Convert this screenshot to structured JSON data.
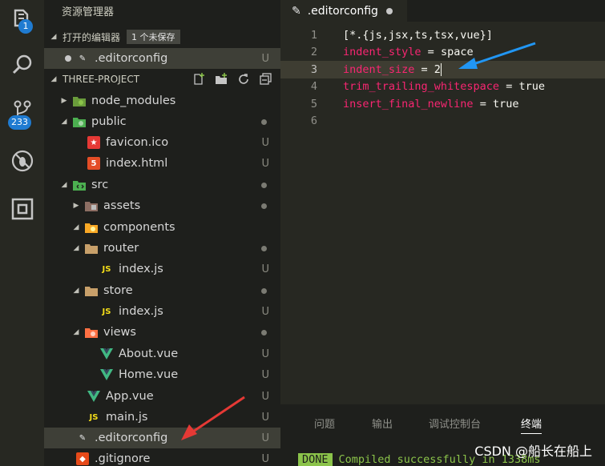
{
  "activity_bar": {
    "explorer_badge": "1",
    "scm_badge": "233"
  },
  "sidebar": {
    "title": "资源管理器",
    "open_editors": {
      "label": "打开的编辑器",
      "unsaved_badge": "1 个未保存",
      "items": [
        {
          "name": ".editorconfig",
          "status": "U"
        }
      ]
    },
    "project": {
      "label": "THREE-PROJECT"
    },
    "tree": [
      {
        "label": "node_modules",
        "status": "",
        "dot": false
      },
      {
        "label": "public",
        "status": "",
        "dot": true
      },
      {
        "label": "favicon.ico",
        "status": "U",
        "dot": false
      },
      {
        "label": "index.html",
        "status": "U",
        "dot": false
      },
      {
        "label": "src",
        "status": "",
        "dot": true
      },
      {
        "label": "assets",
        "status": "",
        "dot": true
      },
      {
        "label": "components",
        "status": "",
        "dot": false
      },
      {
        "label": "router",
        "status": "",
        "dot": true
      },
      {
        "label": "index.js",
        "status": "U",
        "dot": false
      },
      {
        "label": "store",
        "status": "",
        "dot": true
      },
      {
        "label": "index.js",
        "status": "U",
        "dot": false
      },
      {
        "label": "views",
        "status": "",
        "dot": true
      },
      {
        "label": "About.vue",
        "status": "U",
        "dot": false
      },
      {
        "label": "Home.vue",
        "status": "U",
        "dot": false
      },
      {
        "label": "App.vue",
        "status": "U",
        "dot": false
      },
      {
        "label": "main.js",
        "status": "U",
        "dot": false
      },
      {
        "label": ".editorconfig",
        "status": "U",
        "dot": false
      },
      {
        "label": ".gitignore",
        "status": "U",
        "dot": false
      }
    ],
    "icon_glyphs": {
      "js": "JS",
      "html": "5",
      "vue": "V"
    }
  },
  "editor": {
    "tab_label": ".editorconfig",
    "lines": [
      {
        "num": "1",
        "text": "[*.{js,jsx,ts,tsx,vue}]"
      },
      {
        "num": "2",
        "key": "indent_style",
        "eq": " = ",
        "val": "space"
      },
      {
        "num": "3",
        "key": "indent_size",
        "eq": " = ",
        "val": "2"
      },
      {
        "num": "4",
        "key": "trim_trailing_whitespace",
        "eq": " = ",
        "val": "true"
      },
      {
        "num": "5",
        "key": "insert_final_newline",
        "eq": " = ",
        "val": "true"
      },
      {
        "num": "6"
      }
    ]
  },
  "panel": {
    "tabs": [
      "问题",
      "输出",
      "调试控制台",
      "终端"
    ],
    "active_tab": "终端",
    "terminal": {
      "done": "DONE",
      "message": "Compiled successfully in 1338ms"
    },
    "watermark": "CSDN @船长在船上"
  },
  "colors": {
    "background": "#272822",
    "sidebar": "#1e1f1c",
    "keyword": "#f92672",
    "badge": "#1f7bd1",
    "done": "#8bc34a",
    "arrow_blue": "#2196f3",
    "arrow_red": "#e53935"
  }
}
